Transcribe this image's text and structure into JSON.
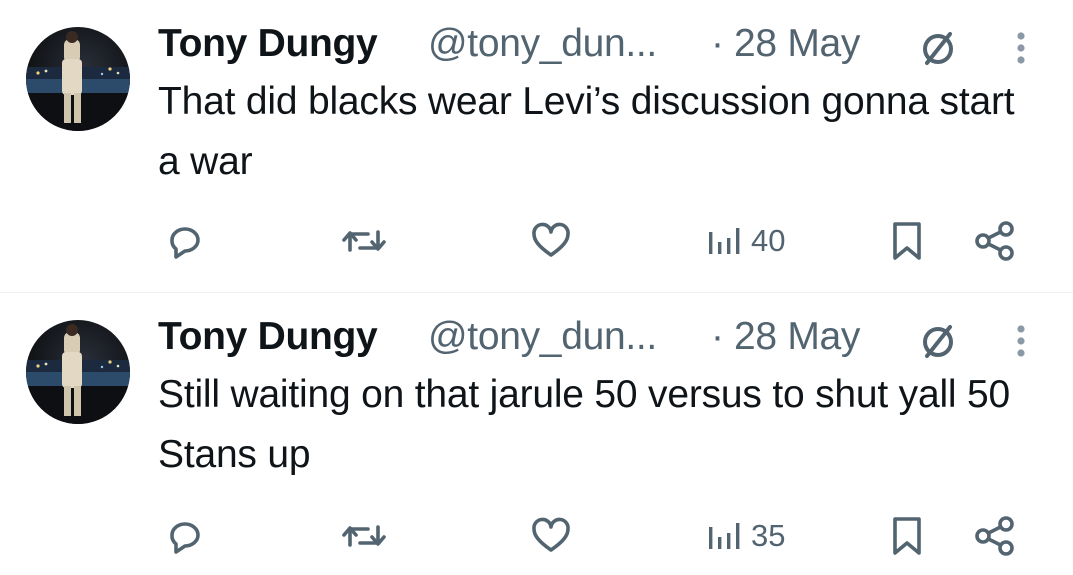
{
  "colors": {
    "text": "#0f1419",
    "secondary": "#536471",
    "divider": "#eff3f4"
  },
  "icons": {
    "edit": "no-edit-icon",
    "more": "more-vertical-icon",
    "reply": "reply-icon",
    "retweet": "retweet-icon",
    "like": "heart-icon",
    "views": "views-icon",
    "bookmark": "bookmark-icon",
    "share": "share-icon"
  },
  "tweets": [
    {
      "author_name": "Tony Dungy",
      "handle": "@tony_dun...",
      "separator": "·",
      "date": "28 May",
      "text": "That did blacks wear Levi’s discussion gonna start a war",
      "views": "40"
    },
    {
      "author_name": "Tony Dungy",
      "handle": "@tony_dun...",
      "separator": "·",
      "date": "28 May",
      "text": "Still waiting on that jarule 50 versus to shut yall 50 Stans up",
      "views": "35"
    }
  ]
}
